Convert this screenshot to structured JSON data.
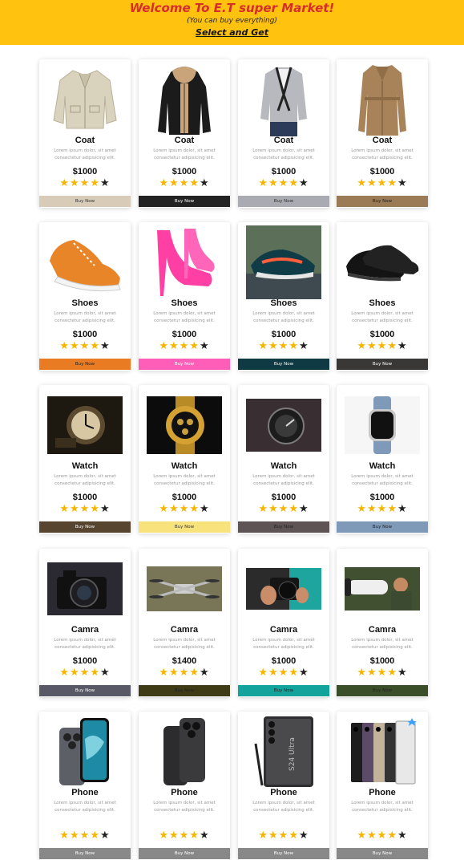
{
  "header": {
    "title": "Welcome To E.T super Market!",
    "subtitle": "(You can buy everything)",
    "cta": "Select and Get",
    "background": "#ffc20e",
    "title_color": "#d62d2d"
  },
  "description": "Lorem ipsum dolor, sit amet consectetur adipisicing elit.",
  "buy_label": "Buy Now",
  "rating": {
    "filled": 4,
    "total": 5
  },
  "products": [
    {
      "name": "Coat",
      "price": "$1000",
      "button_color": "#d8ccb8",
      "button_text_color": "#333",
      "image": "beige-jacket"
    },
    {
      "name": "Coat",
      "price": "$1000",
      "button_color": "#232323",
      "button_text_color": "#fff",
      "image": "black-parka"
    },
    {
      "name": "Coat",
      "price": "$1000",
      "button_color": "#aaaab2",
      "button_text_color": "#333",
      "image": "grey-blazer"
    },
    {
      "name": "Coat",
      "price": "$1000",
      "button_color": "#9b7b55",
      "button_text_color": "#222",
      "image": "trench-coat"
    },
    {
      "name": "Shoes",
      "price": "$1000",
      "button_color": "#e97c22",
      "button_text_color": "#222",
      "image": "orange-sneaker"
    },
    {
      "name": "Shoes",
      "price": "$1000",
      "button_color": "#ff5eb8",
      "button_text_color": "#fff",
      "image": "pink-heels"
    },
    {
      "name": "Shoes",
      "price": "$1000",
      "button_color": "#0f3a43",
      "button_text_color": "#fff",
      "image": "running-shoe"
    },
    {
      "name": "Shoes",
      "price": "$1000",
      "button_color": "#3a3836",
      "button_text_color": "#fff",
      "image": "black-oxfords"
    },
    {
      "name": "Watch",
      "price": "$1000",
      "button_color": "#57452f",
      "button_text_color": "#fff",
      "image": "pocket-watch"
    },
    {
      "name": "Watch",
      "price": "$1000",
      "button_color": "#f7e27c",
      "button_text_color": "#333",
      "image": "gold-watch"
    },
    {
      "name": "Watch",
      "price": "$1000",
      "button_color": "#5e5355",
      "button_text_color": "#222",
      "image": "dark-watch"
    },
    {
      "name": "Watch",
      "price": "$1000",
      "button_color": "#7f99b9",
      "button_text_color": "#222",
      "image": "smart-watch"
    },
    {
      "name": "Camra",
      "price": "$1000",
      "button_color": "#595867",
      "button_text_color": "#fff",
      "image": "dslr-camera"
    },
    {
      "name": "Camra",
      "price": "$1400",
      "button_color": "#3f3b16",
      "button_text_color": "#222",
      "image": "drone"
    },
    {
      "name": "Camra",
      "price": "$1000",
      "button_color": "#12a39d",
      "button_text_color": "#222",
      "image": "hands-camera"
    },
    {
      "name": "Camra",
      "price": "$1000",
      "button_color": "#3b4e2a",
      "button_text_color": "#222",
      "image": "telephoto-lens"
    },
    {
      "name": "Phone",
      "price": "",
      "button_color": "#888",
      "button_text_color": "#fff",
      "image": "iphone-blue"
    },
    {
      "name": "Phone",
      "price": "",
      "button_color": "#888",
      "button_text_color": "#fff",
      "image": "iphone-black"
    },
    {
      "name": "Phone",
      "price": "",
      "button_color": "#888",
      "button_text_color": "#fff",
      "image": "galaxy-s24-ultra"
    },
    {
      "name": "Phone",
      "price": "",
      "button_color": "#888",
      "button_text_color": "#fff",
      "image": "galaxy-s24-lineup"
    }
  ]
}
